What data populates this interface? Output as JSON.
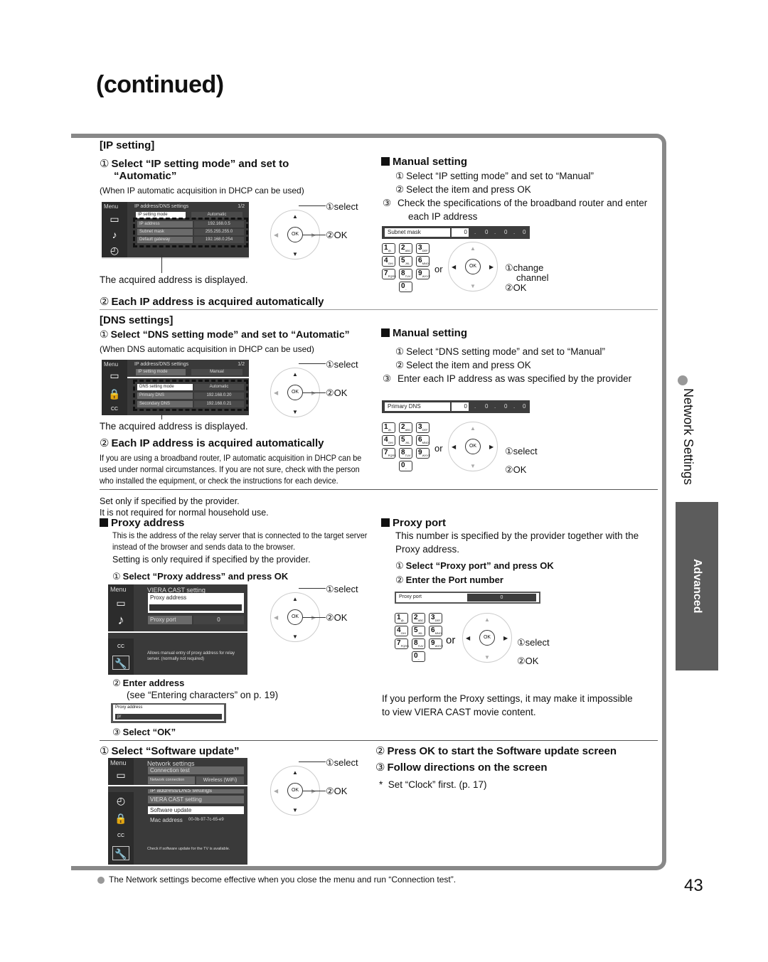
{
  "page_title": "(continued)",
  "page_number": "43",
  "sidebar": {
    "section": "Network Settings",
    "tab": "Advanced"
  },
  "footer_note": "The Network settings become effective when you close the menu and run “Connection test”.",
  "ip_setting": {
    "heading": "[IP setting]",
    "step1": "Select “IP setting mode” and set to",
    "step1_cont": "“Automatic”",
    "step1_note": "(When IP automatic acquisition in DHCP can be used)",
    "screen": {
      "menu": "Menu",
      "title": "IP address/DNS settings",
      "page": "1/2",
      "rows": [
        {
          "key": "IP setting mode",
          "value": "Automatic"
        },
        {
          "key": "IP address",
          "value": "192.168.0.5"
        },
        {
          "key": "Subnet mask",
          "value": "255.255.255.0"
        },
        {
          "key": "Default gateway",
          "value": "192.168.0.254"
        }
      ]
    },
    "caption": "The acquired address is displayed.",
    "step2": "Each IP address is acquired automatically",
    "remote": {
      "select": "select",
      "ok": "OK",
      "ok_btn": "OK"
    },
    "manual": {
      "heading": "Manual setting",
      "steps": [
        "Select “IP setting mode” and set to “Manual”",
        "Select the item and press OK",
        "Check the specifications of the broadband router and enter each IP address"
      ],
      "field": {
        "label": "Subnet mask",
        "values": [
          "0",
          "0",
          "0",
          "0"
        ]
      },
      "or": "or",
      "change": "change",
      "channel": "channel",
      "ok": "OK"
    }
  },
  "dns_settings": {
    "heading": "[DNS settings]",
    "step1": "Select “DNS setting mode” and set to “Automatic”",
    "step1_note": "(When DNS automatic acquisition in DHCP can be used)",
    "screen": {
      "menu": "Menu",
      "title": "IP address/DNS settings",
      "page": "1/2",
      "rows": [
        {
          "key": "IP setting mode",
          "value": "Manual"
        },
        {
          "key": "DNS setting mode",
          "value": "Automatic"
        },
        {
          "key": "Primary DNS",
          "value": "192.168.0.20"
        },
        {
          "key": "Secondary DNS",
          "value": "192.168.0.21"
        }
      ]
    },
    "caption": "The acquired address is displayed.",
    "step2": "Each IP address is acquired automatically",
    "step2_note": "If you are using a broadband router, IP automatic acquisition in DHCP can be used under normal circumstances. If you are not sure, check with the person who installed the equipment, or check the instructions for each device.",
    "remote": {
      "select": "select",
      "ok": "OK",
      "ok_btn": "OK"
    },
    "manual": {
      "heading": "Manual setting",
      "steps": [
        "Select “DNS setting mode” and set to “Manual”",
        "Select the item and press OK",
        "Enter each IP address as was specified by the provider"
      ],
      "field": {
        "label": "Primary DNS",
        "values": [
          "0",
          "0",
          "0",
          "0"
        ]
      },
      "or": "or",
      "select": "select",
      "ok": "OK"
    }
  },
  "proxy": {
    "intro1": "Set only if specified by the provider.",
    "intro2": "It is not required for normal household use.",
    "address": {
      "heading": "Proxy address",
      "desc": "This is the address of the relay server that is connected to the target server instead of the browser and sends data to the browser.",
      "desc2": "Setting is only required if specified by the provider.",
      "step1": "Select “Proxy address” and press OK",
      "screen": {
        "menu": "Menu",
        "title": "VIERA CAST setting",
        "proxy_address": "Proxy address",
        "proxy_port": "Proxy port",
        "proxy_port_value": "0",
        "help": "Allows manual entry of proxy address for relay server. (normally not required)"
      },
      "step2": "Enter address",
      "step2_note": "(see “Entering characters” on p. 19)",
      "input": {
        "label": "Proxy address",
        "value": "pr"
      },
      "step3": "Select “OK”",
      "remote": {
        "select": "select",
        "ok": "OK",
        "ok_btn": "OK"
      }
    },
    "port": {
      "heading": "Proxy port",
      "desc": "This number is specified by the provider together with the Proxy address.",
      "step1": "Select “Proxy port” and press OK",
      "step2": "Enter the Port number",
      "field": {
        "label": "Proxy port",
        "value": "0"
      },
      "or": "or",
      "select": "select",
      "ok": "OK",
      "warning": "If you perform the Proxy settings, it may make it impossible to view VIERA CAST movie content."
    }
  },
  "software_update": {
    "step1": "Select “Software update”",
    "step2": "Press OK to start the Software update screen",
    "step3": "Follow directions on the screen",
    "note": "Set “Clock” first. (p. 17)",
    "screen": {
      "menu": "Menu",
      "title": "Network settings",
      "items": [
        "Connection test",
        "IP address/DNS settings",
        "VIERA CAST setting",
        "Software update"
      ],
      "network_connection_label": "Network connection",
      "network_connection_value": "Wireless (WiFi)",
      "mac_label": "Mac address",
      "mac_value": "00-0b-97-7c-65-e9",
      "help": "Check if software update for the TV is available."
    },
    "remote": {
      "select": "select",
      "ok": "OK",
      "ok_btn": "OK"
    }
  },
  "keypad": [
    {
      "d": "1",
      "s": "@."
    },
    {
      "d": "2",
      "s": "ABC"
    },
    {
      "d": "3",
      "s": "DEF"
    },
    {
      "d": "4",
      "s": "GHI"
    },
    {
      "d": "5",
      "s": "JKL"
    },
    {
      "d": "6",
      "s": "MNO"
    },
    {
      "d": "7",
      "s": "PQRS"
    },
    {
      "d": "8",
      "s": "TUV"
    },
    {
      "d": "9",
      "s": "WXYZ"
    },
    {
      "d": "0",
      "s": "-."
    }
  ],
  "circled": [
    "①",
    "②",
    "③"
  ]
}
